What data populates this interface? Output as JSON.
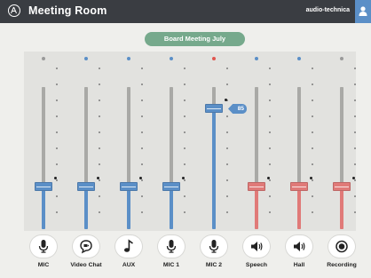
{
  "header": {
    "title": "Meeting Room",
    "brand": "audio-technica"
  },
  "session": {
    "name": "Board Meeting July"
  },
  "colors": {
    "blue": "#5b8fc7",
    "red": "#e07a78",
    "led_off": "#9a9a9a",
    "led_blue": "#5b8fc7",
    "led_red": "#e0564f"
  },
  "channels": [
    {
      "label": "MIC",
      "icon": "microphone-icon",
      "color": "blue",
      "led": "off",
      "level": 0.3
    },
    {
      "label": "Video Chat",
      "icon": "chat-icon",
      "color": "blue",
      "led": "blue",
      "level": 0.3
    },
    {
      "label": "AUX",
      "icon": "music-note-icon",
      "color": "blue",
      "led": "blue",
      "level": 0.3
    },
    {
      "label": "MIC 1",
      "icon": "microphone-icon",
      "color": "blue",
      "led": "blue",
      "level": 0.3
    },
    {
      "label": "MIC 2",
      "icon": "microphone-icon",
      "color": "blue",
      "led": "red",
      "level": 0.85,
      "value": "85"
    },
    {
      "label": "Speech",
      "icon": "speaker-icon",
      "color": "red",
      "led": "blue",
      "level": 0.3
    },
    {
      "label": "Hall",
      "icon": "speaker-icon",
      "color": "red",
      "led": "blue",
      "level": 0.3
    },
    {
      "label": "Recording",
      "icon": "record-icon",
      "color": "red",
      "led": "off",
      "level": 0.3
    }
  ]
}
